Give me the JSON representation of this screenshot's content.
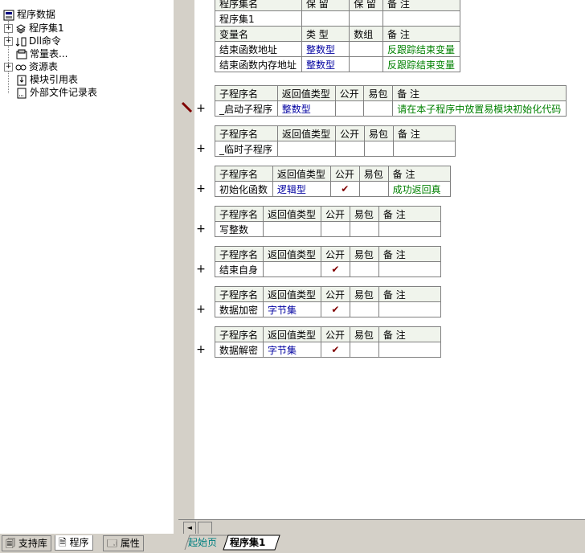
{
  "tree": {
    "root": "程序数据",
    "items": [
      {
        "label": "程序集1",
        "icon": "stack-icon",
        "expander": "+"
      },
      {
        "label": "Dll命令",
        "icon": "dll-icon",
        "expander": "+"
      },
      {
        "label": "常量表...",
        "icon": "constants-icon",
        "expander": ""
      },
      {
        "label": "资源表",
        "icon": "resources-icon",
        "expander": "+"
      },
      {
        "label": "模块引用表",
        "icon": "module-ref-icon",
        "expander": ""
      },
      {
        "label": "外部文件记录表",
        "icon": "file-record-icon",
        "expander": ""
      }
    ]
  },
  "left_tabs": [
    {
      "label": "支持库",
      "icon": "library-icon"
    },
    {
      "label": "程序",
      "icon": "program-icon"
    },
    {
      "label": "属性",
      "icon": "property-icon"
    }
  ],
  "assembly": {
    "headers": [
      "程序集名",
      "保 留",
      "保 留",
      "备 注"
    ],
    "name": "程序集1",
    "var_headers": [
      "变量名",
      "类 型",
      "数组",
      "备 注"
    ],
    "vars": [
      {
        "name": "结束函数地址",
        "type": "整数型",
        "array": "",
        "note": "反跟踪结束变量"
      },
      {
        "name": "结束函数内存地址",
        "type": "整数型",
        "array": "",
        "note": "反跟踪结束变量"
      }
    ]
  },
  "sub_headers": [
    "子程序名",
    "返回值类型",
    "公开",
    "易包",
    "备 注"
  ],
  "check_mark": "✔",
  "plus": "+",
  "subs": [
    {
      "name": "_启动子程序",
      "ret": "整数型",
      "public": "",
      "easy": "",
      "note": "请在本子程序中放置易模块初始化代码"
    },
    {
      "name": "_临时子程序",
      "ret": "",
      "public": "",
      "easy": "",
      "note": ""
    },
    {
      "name": "初始化函数",
      "ret": "逻辑型",
      "public": "✔",
      "easy": "",
      "note": "成功返回真"
    },
    {
      "name": "写整数",
      "ret": "",
      "public": "",
      "easy": "",
      "note": ""
    },
    {
      "name": "结束自身",
      "ret": "",
      "public": "✔",
      "easy": "",
      "note": ""
    },
    {
      "name": "数据加密",
      "ret": "字节集",
      "public": "✔",
      "easy": "",
      "note": ""
    },
    {
      "name": "数据解密",
      "ret": "字节集",
      "public": "✔",
      "easy": "",
      "note": ""
    }
  ],
  "doc_tabs": [
    {
      "label": "起始页",
      "active": false
    },
    {
      "label": "程序集1",
      "active": true
    }
  ],
  "colors": {
    "type": "#0000a0",
    "comment": "#008000",
    "check": "#800000",
    "header_bg": "#f0f4ec"
  }
}
